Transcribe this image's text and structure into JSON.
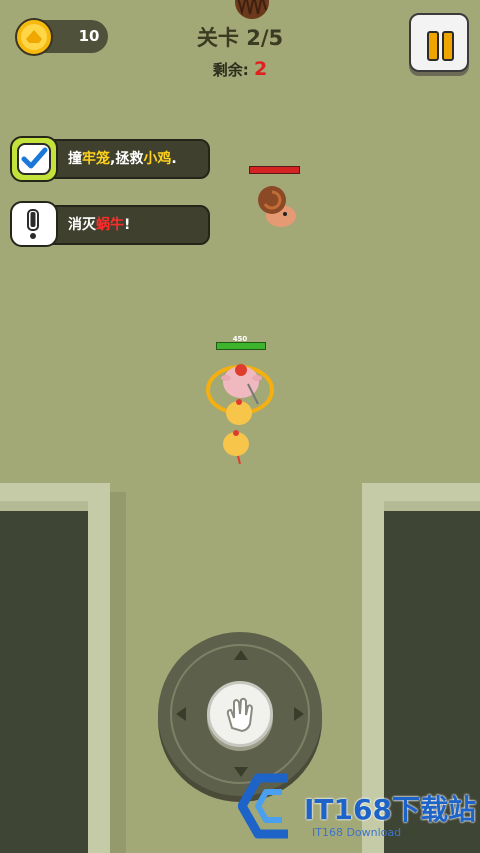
{
  "hud": {
    "coins": "10",
    "level_title": "关卡 2/5",
    "remaining_label": "剩余:",
    "remaining_count": "2"
  },
  "quests": [
    {
      "prefix": "撞",
      "highlight": "牢笼",
      "middle": ",拯救",
      "highlight2": "小鸡",
      "suffix": ".",
      "status": "done"
    },
    {
      "prefix": "消灭",
      "highlight": "蜗牛",
      "suffix": "!",
      "status": "pending"
    }
  ],
  "player": {
    "hp_label": "450"
  },
  "watermark": {
    "brand": "IT168下载站",
    "sub": "IT168 Download"
  },
  "colors": {
    "ground": "#a3a877",
    "accent_yellow": "#ffd21e",
    "accent_red": "#ff2b2b",
    "check_panel": "#c3e33a"
  },
  "icons": [
    "coin-icon",
    "pause-icon",
    "check-icon",
    "exclamation-icon",
    "joystick-arrow-icons"
  ]
}
